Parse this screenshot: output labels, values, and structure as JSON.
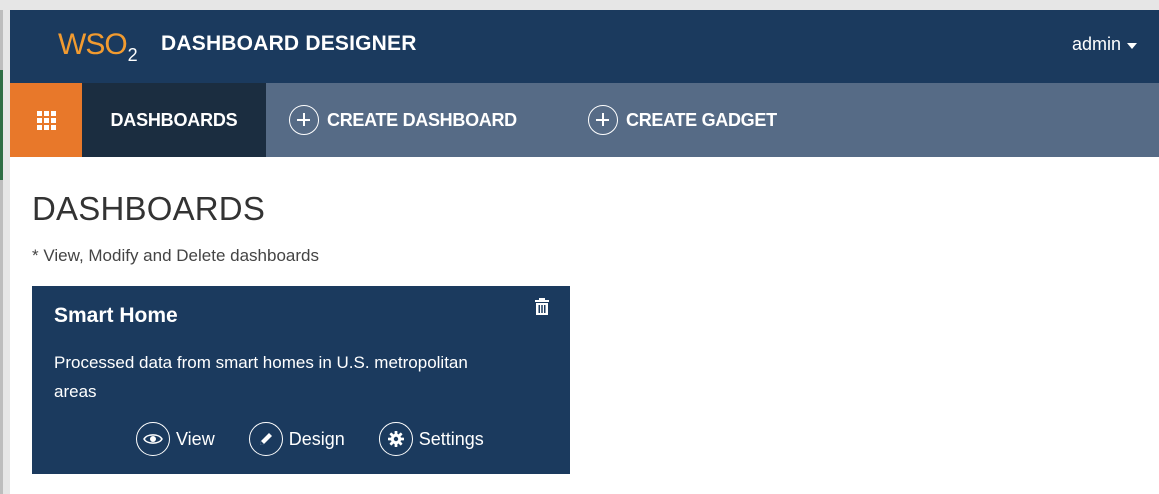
{
  "header": {
    "logo_text": "WSO",
    "logo_sub": "2",
    "title": "DASHBOARD DESIGNER",
    "user": "admin"
  },
  "nav": {
    "grid_icon": "app-grid-icon",
    "active_label": "DASHBOARDS",
    "items": [
      {
        "label": "CREATE DASHBOARD",
        "icon": "plus-circle-icon"
      },
      {
        "label": "CREATE GADGET",
        "icon": "plus-circle-icon"
      }
    ]
  },
  "main": {
    "title": "DASHBOARDS",
    "subtitle": "* View, Modify and Delete dashboards",
    "cards": [
      {
        "title": "Smart Home",
        "description": "Processed data from smart homes in U.S. metropolitan areas",
        "delete_icon": "trash-icon",
        "actions": [
          {
            "label": "View",
            "icon": "eye-icon"
          },
          {
            "label": "Design",
            "icon": "pencil-icon"
          },
          {
            "label": "Settings",
            "icon": "gear-icon"
          }
        ]
      }
    ]
  },
  "colors": {
    "header_bg": "#1b3a5e",
    "nav_bg": "#566b86",
    "nav_active_bg": "#1b2d40",
    "accent_orange": "#e8782a",
    "card_bg": "#1b3a5e"
  }
}
